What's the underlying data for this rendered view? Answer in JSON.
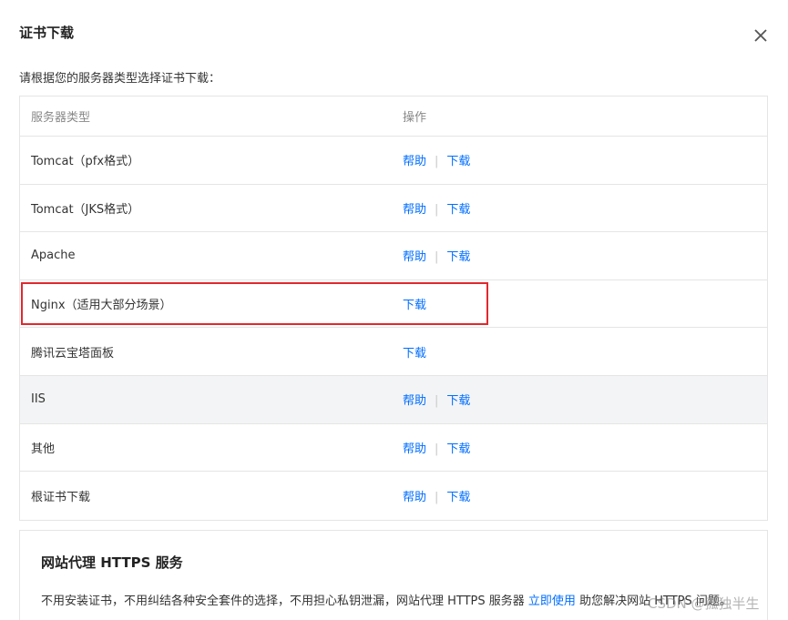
{
  "dialog": {
    "title": "证书下载",
    "close_icon": "close-icon"
  },
  "intro": "请根据您的服务器类型选择证书下载：",
  "table": {
    "headers": [
      "服务器类型",
      "操作"
    ],
    "help_label": "帮助",
    "separator": "|",
    "download_label": "下载",
    "rows": [
      {
        "server_type": "Tomcat（pfx格式）",
        "has_help": true
      },
      {
        "server_type": "Tomcat（JKS格式）",
        "has_help": true
      },
      {
        "server_type": "Apache",
        "has_help": true
      },
      {
        "server_type": "Nginx（适用大部分场景）",
        "has_help": false
      },
      {
        "server_type": "腾讯云宝塔面板",
        "has_help": false
      },
      {
        "server_type": "IIS",
        "has_help": true,
        "shaded": true
      },
      {
        "server_type": "其他",
        "has_help": true
      },
      {
        "server_type": "根证书下载",
        "has_help": true
      }
    ]
  },
  "highlight_color": "#e0292e",
  "link_color": "#006eff",
  "proxy": {
    "title": "网站代理 HTTPS 服务",
    "desc_before": "不用安装证书，不用纠结各种安全套件的选择，不用担心私钥泄漏，网站代理 HTTPS 服务器 ",
    "link": "立即使用",
    "desc_after": " 助您解决网站 HTTPS 问题。"
  },
  "watermark": "CSDN @孤独半生"
}
